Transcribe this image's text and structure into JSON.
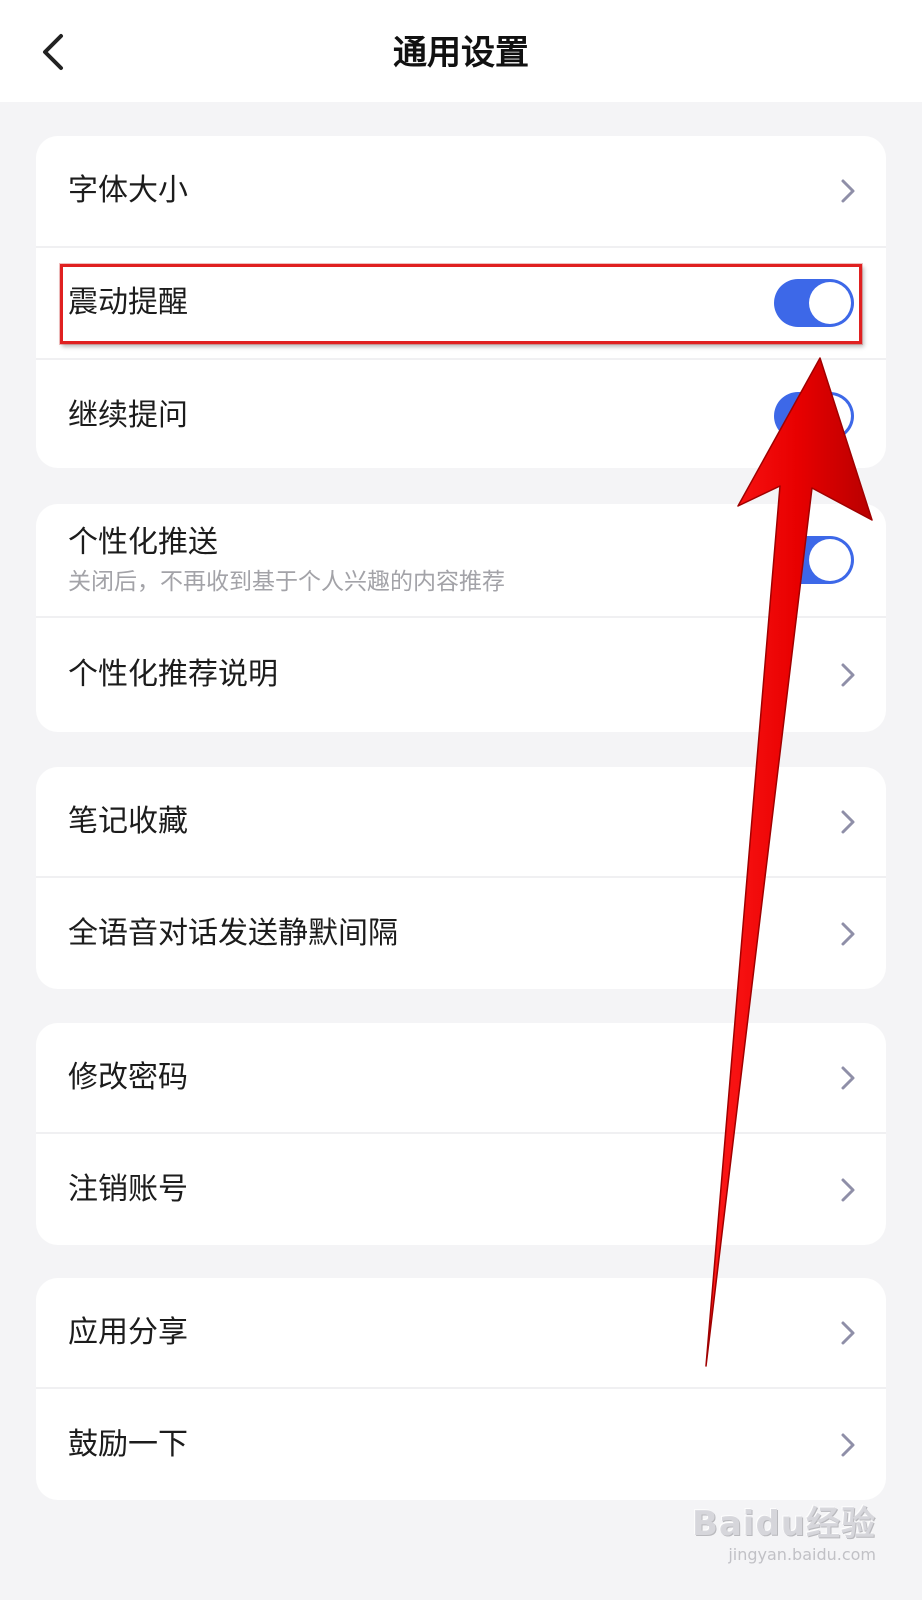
{
  "header": {
    "title": "通用设置"
  },
  "groups": [
    {
      "items": [
        {
          "label": "字体大小",
          "control": "chevron"
        },
        {
          "label": "震动提醒",
          "control": "toggle",
          "on": true
        },
        {
          "label": "继续提问",
          "control": "toggle",
          "on": true
        }
      ]
    },
    {
      "items": [
        {
          "label": "个性化推送",
          "sublabel": "关闭后，不再收到基于个人兴趣的内容推荐",
          "control": "toggle",
          "on": true
        },
        {
          "label": "个性化推荐说明",
          "control": "chevron"
        }
      ]
    },
    {
      "items": [
        {
          "label": "笔记收藏",
          "control": "chevron"
        },
        {
          "label": "全语音对话发送静默间隔",
          "control": "chevron"
        }
      ]
    },
    {
      "items": [
        {
          "label": "修改密码",
          "control": "chevron"
        },
        {
          "label": "注销账号",
          "control": "chevron"
        }
      ]
    },
    {
      "items": [
        {
          "label": "应用分享",
          "control": "chevron"
        },
        {
          "label": "鼓励一下",
          "control": "chevron"
        }
      ]
    }
  ],
  "watermark": {
    "logo_text": "Baidu经验",
    "url": "jingyan.baidu.com"
  },
  "colors": {
    "toggle_on": "#3d68e8",
    "annotation_red": "#e02020",
    "chevron": "#8f8fa8",
    "background": "#f4f4f6"
  }
}
